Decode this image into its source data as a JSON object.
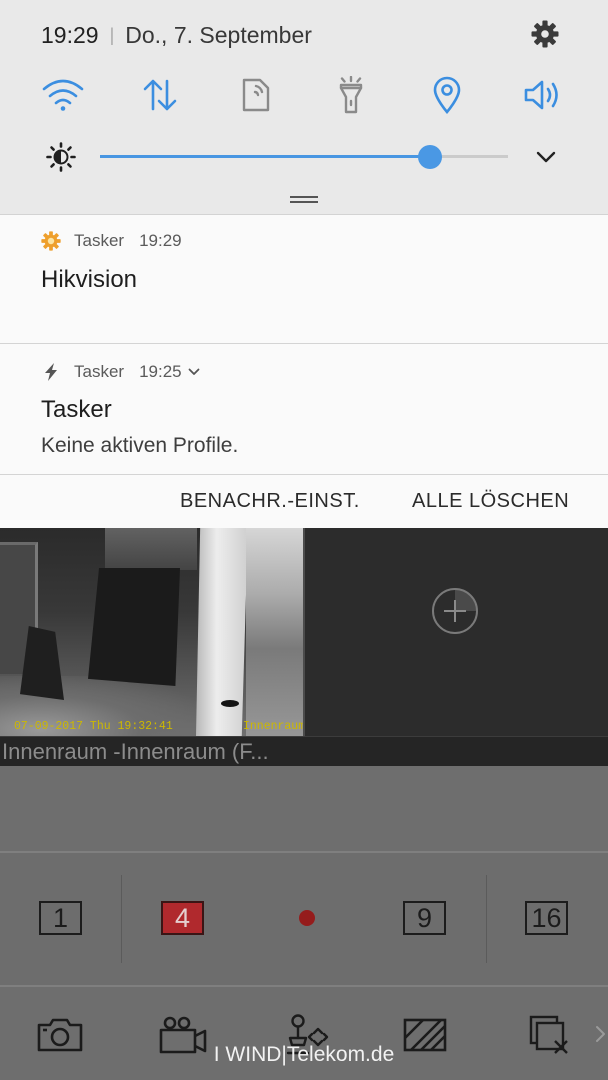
{
  "colors": {
    "accent": "#3b8ee0",
    "inactive": "#8a8a8a",
    "selected_layout": "#b0292d",
    "osd_text": "#cdb800"
  },
  "status_bar": {
    "time": "19:29",
    "separator": "|",
    "date": "Do., 7. September",
    "settings_icon": "gear-icon"
  },
  "quick_toggles": [
    {
      "icon": "wifi-icon",
      "active": true
    },
    {
      "icon": "mobile-data-icon",
      "active": true
    },
    {
      "icon": "smart-view-icon",
      "active": false
    },
    {
      "icon": "flashlight-icon",
      "active": false
    },
    {
      "icon": "location-icon",
      "active": true
    },
    {
      "icon": "sound-icon",
      "active": true
    }
  ],
  "brightness": {
    "icon": "brightness-icon",
    "level": 0.81,
    "expand_icon": "chevron-down-icon"
  },
  "notifications": [
    {
      "app": "Tasker",
      "time": "19:29",
      "title": "Hikvision",
      "icon": "tasker-gear-icon"
    },
    {
      "app": "Tasker",
      "time": "19:25",
      "title": "Tasker",
      "text": "Keine aktiven Profile.",
      "icon": "lightning-icon",
      "expand_icon": "chevron-down-icon"
    }
  ],
  "notification_actions": {
    "settings": "BENACHR.-EINST.",
    "clear_all": "ALLE LÖSCHEN"
  },
  "live_view": {
    "cells": [
      {
        "label": "Innenraum -Innenraum (F...",
        "osd_datetime": "07-09-2017 Thu 19:32:41",
        "osd_name": "Innenraum"
      },
      {
        "empty": true,
        "icon": "add-camera-icon"
      }
    ]
  },
  "layout_buttons": [
    {
      "label": "1",
      "selected": false
    },
    {
      "label": "4",
      "selected": true
    },
    {
      "label": "9",
      "selected": false
    },
    {
      "label": "16",
      "selected": false
    }
  ],
  "page_indicator": {
    "icon": "page-dot"
  },
  "toolbar": [
    {
      "icon": "snapshot-icon"
    },
    {
      "icon": "record-icon"
    },
    {
      "icon": "ptz-icon"
    },
    {
      "icon": "image-enhance-icon"
    },
    {
      "icon": "close-all-icon"
    },
    {
      "icon": "chevron-right-icon"
    }
  ],
  "carrier": "I WIND|Telekom.de"
}
